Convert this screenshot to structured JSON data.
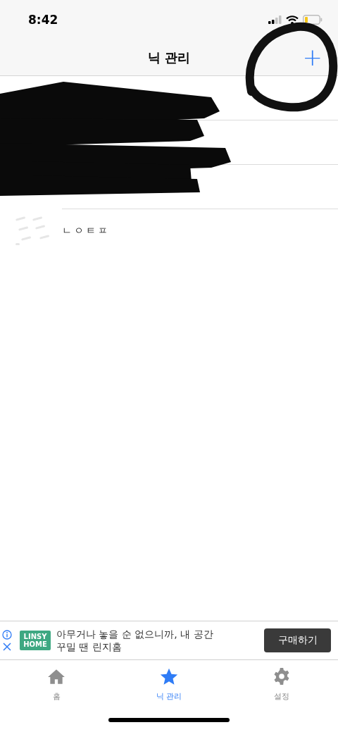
{
  "status_bar": {
    "time": "8:42"
  },
  "nav_bar": {
    "title": "닉 관리",
    "add_button": "+"
  },
  "rows": [
    {
      "kind": "redacted"
    },
    {
      "kind": "redacted"
    },
    {
      "kind": "redacted"
    },
    {
      "kind": "item",
      "name": "ㄴㅇㅌㅍ"
    }
  ],
  "ad": {
    "logo": [
      "LINSY",
      "HOME"
    ],
    "text": "아무거나 놓을 순 없으니까, 내 공간 꾸밀 땐 린지홈",
    "button": "구매하기"
  },
  "tabs": [
    {
      "label": "홈",
      "kind": "home",
      "selected": false
    },
    {
      "label": "닉 관리",
      "kind": "favorites",
      "selected": true
    },
    {
      "label": "설정",
      "kind": "settings",
      "selected": false
    }
  ]
}
